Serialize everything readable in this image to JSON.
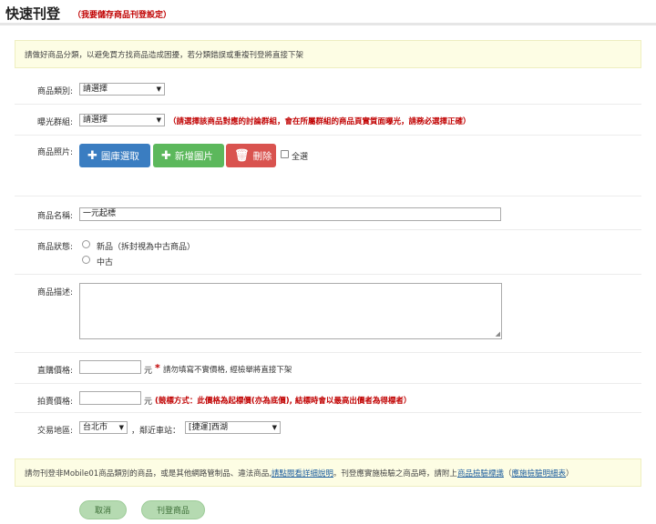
{
  "header": {
    "title": "快速刊登",
    "save_link": "（我要儲存商品刊登設定）"
  },
  "top_notice": "請做好商品分類，以避免買方找商品造成困擾，若分類錯誤或重複刊登將直接下架",
  "form": {
    "category": {
      "label": "商品類別:",
      "value": "請選擇"
    },
    "group": {
      "label": "曝光群組:",
      "value": "請選擇",
      "hint": "（請選擇該商品對應的討論群組，會在所屬群組的商品頁實質面曝光，請務必選擇正確）"
    },
    "photos": {
      "label": "商品照片:",
      "library_button": "圖庫選取",
      "add_button": "新增圖片",
      "delete_button": "刪除",
      "select_all": "全選"
    },
    "name": {
      "label": "商品名稱:",
      "value": "一元起標"
    },
    "condition": {
      "label": "商品狀態:",
      "options": [
        "新品（拆封視為中古商品）",
        "中古"
      ]
    },
    "description": {
      "label": "商品描述:"
    },
    "buy_price": {
      "label": "直購價格:",
      "unit": "元",
      "asterisk": "*",
      "hint": "請勿填寫不實價格, 經檢舉將直接下架"
    },
    "auction_price": {
      "label": "拍賣價格:",
      "unit": "元",
      "hint": "(競標方式：此價格為起標價(亦為底價), 結標時會以最高出價者為得標者）"
    },
    "location": {
      "label": "交易地區:",
      "city": "台北市",
      "station_label": "，鄰近車站：",
      "station": "[捷運]西湖"
    }
  },
  "bottom_notice": {
    "part1": "請勿刊登非Mobile01商品類別的商品，或是其他網路管制品、違法商品,",
    "link1": "請點閱看詳細說明",
    "part2": "。刊登應實施檢驗之商品時，請附上",
    "link2": "商品檢驗標識",
    "part3": "（",
    "link3": "應施檢驗明細表",
    "part4": "）"
  },
  "actions": {
    "cancel": "取消",
    "submit": "刊登商品"
  }
}
